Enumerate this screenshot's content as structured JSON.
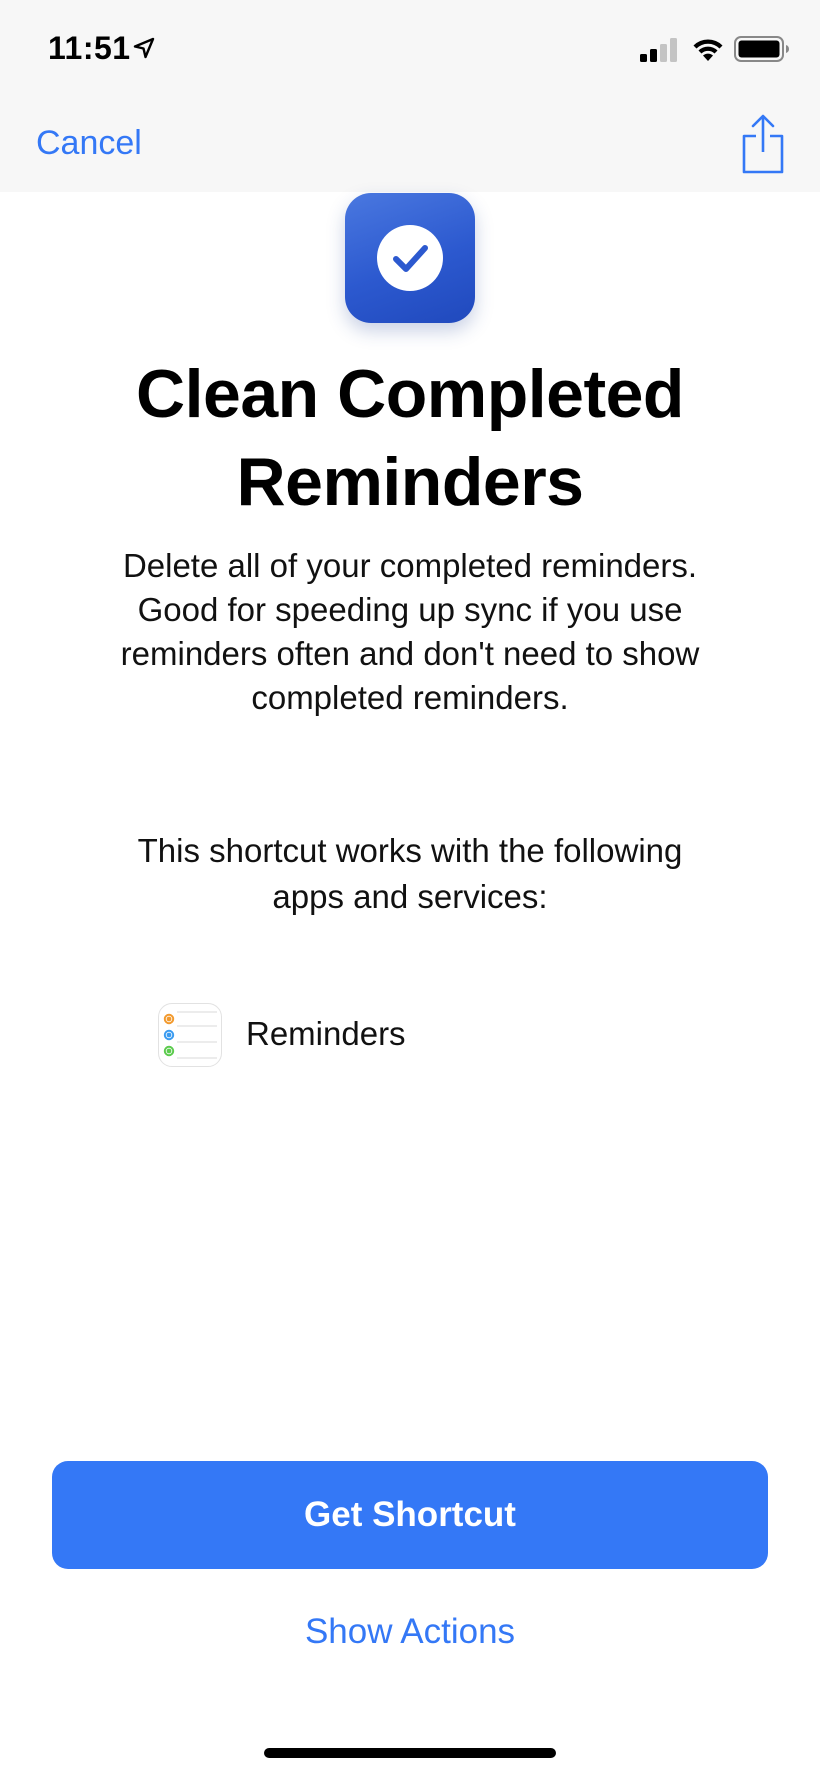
{
  "status_bar": {
    "time": "11:51",
    "icons": [
      "location-arrow-icon",
      "cellular-signal-icon",
      "wifi-icon",
      "battery-icon"
    ]
  },
  "nav": {
    "cancel_label": "Cancel",
    "share_icon": "share-icon"
  },
  "shortcut": {
    "icon": "checkmark-icon",
    "icon_color": "#2c59cf",
    "title_line1": "Clean Completed",
    "title_line2": "Reminders",
    "description_lines": [
      "Delete all of your completed reminders.",
      "Good for speeding up sync if you use",
      "reminders often and don't need to show",
      "completed reminders."
    ]
  },
  "works_with": {
    "lines": [
      "This shortcut works with the following",
      "apps and services:"
    ],
    "apps": [
      {
        "name": "Reminders",
        "icon": "reminders-app-icon"
      }
    ]
  },
  "actions": {
    "get_label": "Get Shortcut",
    "show_actions_label": "Show Actions"
  },
  "colors": {
    "accent": "#3478f6",
    "bar_background": "#f7f7f7"
  }
}
